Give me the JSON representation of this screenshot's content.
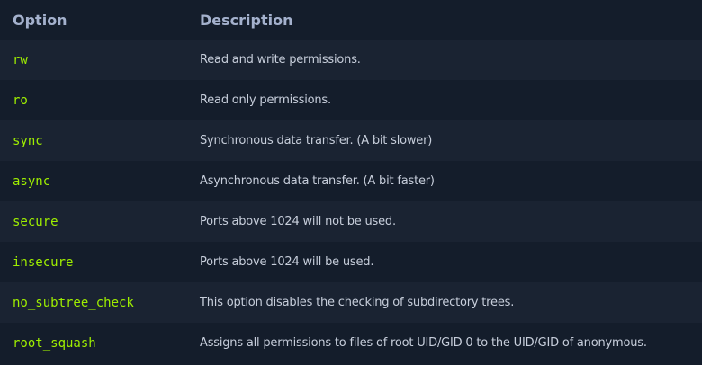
{
  "table": {
    "headers": {
      "option": "Option",
      "description": "Description"
    },
    "rows": [
      {
        "option": "rw",
        "description": "Read and write permissions."
      },
      {
        "option": "ro",
        "description": "Read only permissions."
      },
      {
        "option": "sync",
        "description": "Synchronous data transfer. (A bit slower)"
      },
      {
        "option": "async",
        "description": "Asynchronous data transfer. (A bit faster)"
      },
      {
        "option": "secure",
        "description": "Ports above 1024 will not be used."
      },
      {
        "option": "insecure",
        "description": "Ports above 1024 will be used."
      },
      {
        "option": "no_subtree_check",
        "description": "This option disables the checking of subdirectory trees."
      },
      {
        "option": "root_squash",
        "description": "Assigns all permissions to files of root UID/GID 0 to the UID/GID of anonymous."
      }
    ]
  },
  "colors": {
    "background": "#141d2b",
    "row_alt": "#1a2332",
    "header_text": "#a4b1cd",
    "option_text": "#9fef00",
    "description_text": "#c7cedb"
  }
}
